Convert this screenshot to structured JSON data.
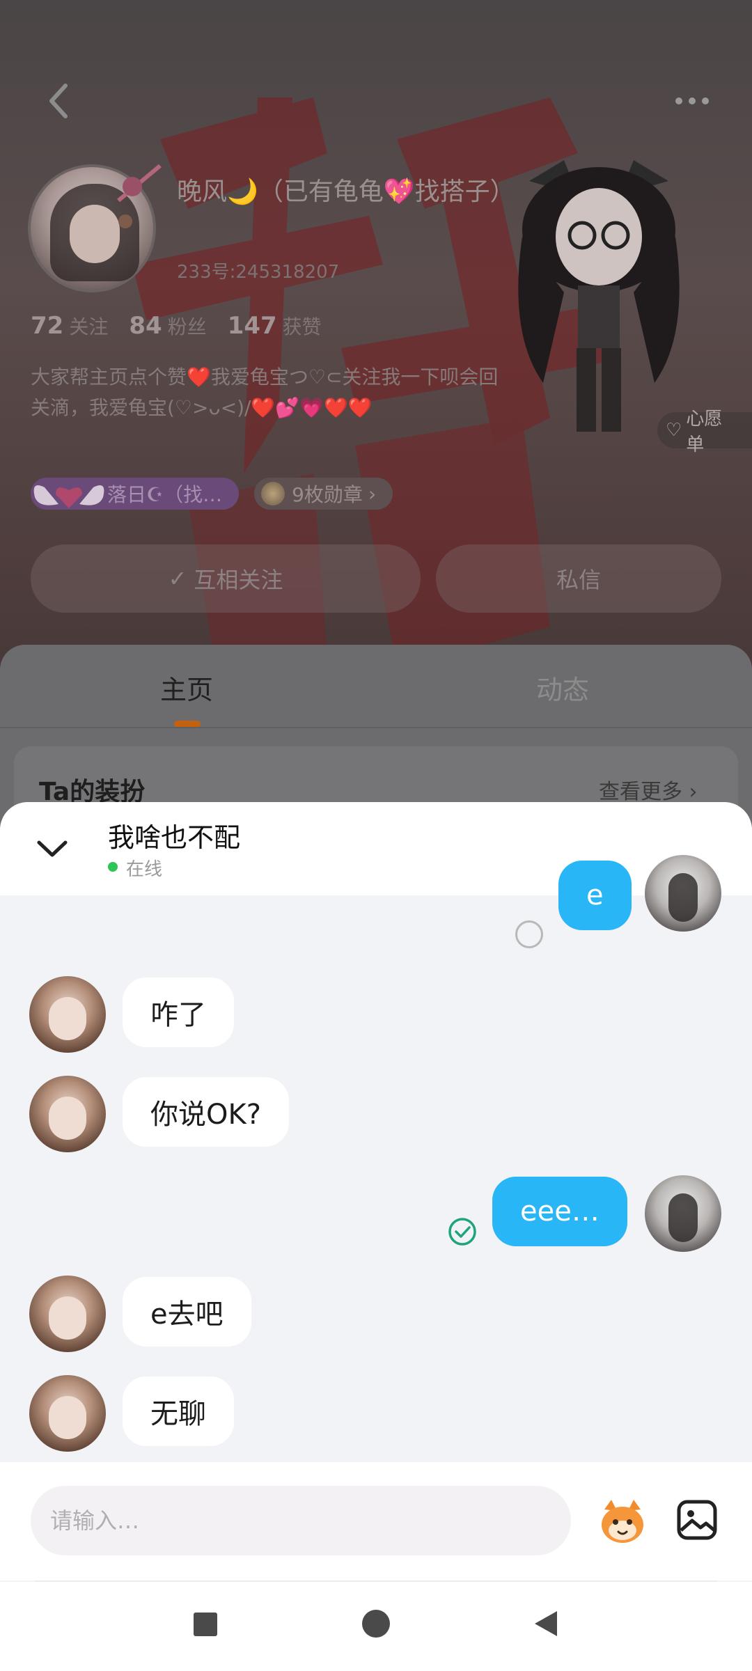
{
  "status_bar": {
    "left_text": ""
  },
  "profile": {
    "nickname": "晚风🌙（已有龟龟💖找搭子）",
    "uid": "233号:245318207",
    "stats": [
      {
        "num": "72",
        "label": "关注"
      },
      {
        "num": "84",
        "label": "粉丝"
      },
      {
        "num": "147",
        "label": "获赞"
      }
    ],
    "bio": "大家帮主页点个赞❤️我爱龟宝つ♡⊂关注我一下呗会回关滴，我爱龟宝(♡>ᴗ<)/❤️💕💗❤️❤️",
    "badge_label": "落日☪（找…",
    "medal_label": "9枚勋章",
    "medal_chevron": "›",
    "follow_label": "互相关注",
    "follow_check": "✓",
    "dm_label": "私信",
    "wish_label": "心愿单",
    "wish_heart": "♡"
  },
  "tabs": [
    {
      "label": "主页"
    },
    {
      "label": "动态"
    }
  ],
  "dress": {
    "title": "Ta的装扮",
    "more": "查看更多 ›"
  },
  "chat": {
    "contact_name": "我啥也不配",
    "online_status": "在线",
    "messages": [
      {
        "side": "out",
        "text": "e",
        "status": "sent"
      },
      {
        "side": "in",
        "text": "咋了"
      },
      {
        "side": "in",
        "text": "你说OK?"
      },
      {
        "side": "out",
        "text": "eee…",
        "status": "read"
      },
      {
        "side": "in",
        "text": "e去吧"
      },
      {
        "side": "in",
        "text": "无聊"
      }
    ]
  },
  "input": {
    "placeholder": "请输入…"
  },
  "icons": {
    "back": "chevron-left-icon",
    "more": "more-dots-icon",
    "collapse": "chevron-down-icon",
    "emoji": "emoji-mascot-icon",
    "image": "image-icon"
  },
  "colors": {
    "accent_blue": "#29b6f6",
    "online_green": "#2fc554",
    "tab_indicator": "#c4610e",
    "read_check": "#1fa37a"
  }
}
